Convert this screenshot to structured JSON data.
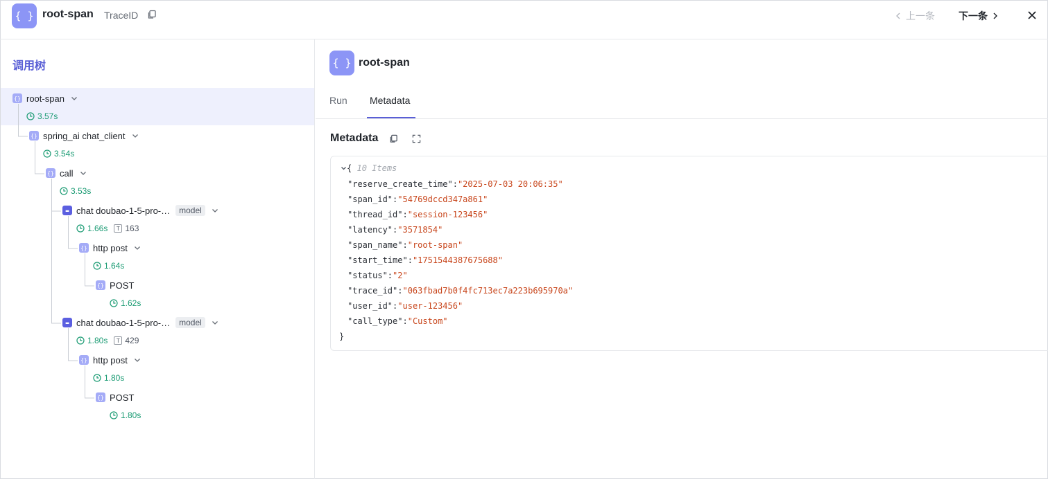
{
  "header": {
    "icon_glyph": "{ }",
    "title": "root-span",
    "trace_label": "TraceID",
    "prev_label": "上一条",
    "next_label": "下一条"
  },
  "tree": {
    "title": "调用树",
    "nodes": [
      {
        "label": "root-span",
        "icon": "braces-icon",
        "duration": "3.57s",
        "selected": true
      },
      {
        "label": "spring_ai chat_client",
        "icon": "braces-icon",
        "duration": "3.54s"
      },
      {
        "label": "call",
        "icon": "braces-icon",
        "duration": "3.53s"
      },
      {
        "label": "chat doubao-1-5-pro-…",
        "icon": "model-icon",
        "tag": "model",
        "duration": "1.66s",
        "tokens": "163"
      },
      {
        "label": "http post",
        "icon": "braces-icon",
        "duration": "1.64s"
      },
      {
        "label": "POST",
        "icon": "braces-icon",
        "duration": "1.62s"
      },
      {
        "label": "chat doubao-1-5-pro-…",
        "icon": "model-icon",
        "tag": "model",
        "duration": "1.80s",
        "tokens": "429"
      },
      {
        "label": "http post",
        "icon": "braces-icon",
        "duration": "1.80s"
      },
      {
        "label": "POST",
        "icon": "braces-icon",
        "duration": "1.80s"
      }
    ],
    "token_glyph": "T"
  },
  "detail": {
    "title": "root-span",
    "tabs": [
      {
        "label": "Run",
        "active": false
      },
      {
        "label": "Metadata",
        "active": true
      }
    ],
    "section_title": "Metadata",
    "json": {
      "open_brace": "{",
      "close_brace": "}",
      "item_count": "10 Items",
      "entries": [
        {
          "key": "\"reserve_create_time\"",
          "value": "\"2025-07-03 20:06:35\""
        },
        {
          "key": "\"span_id\"",
          "value": "\"54769dccd347a861\""
        },
        {
          "key": "\"thread_id\"",
          "value": "\"session-123456\""
        },
        {
          "key": "\"latency\"",
          "value": "\"3571854\""
        },
        {
          "key": "\"span_name\"",
          "value": "\"root-span\""
        },
        {
          "key": "\"start_time\"",
          "value": "\"1751544387675688\""
        },
        {
          "key": "\"status\"",
          "value": "\"2\""
        },
        {
          "key": "\"trace_id\"",
          "value": "\"063fbad7b0f4fc713ec7a223b695970a\""
        },
        {
          "key": "\"user_id\"",
          "value": "\"user-123456\""
        },
        {
          "key": "\"call_type\"",
          "value": "\"Custom\""
        }
      ]
    }
  },
  "colors": {
    "accent": "#5a5fd6",
    "icon_bg": "#8c95f6",
    "duration_green": "#1a9b73",
    "json_value": "#c8461c"
  }
}
